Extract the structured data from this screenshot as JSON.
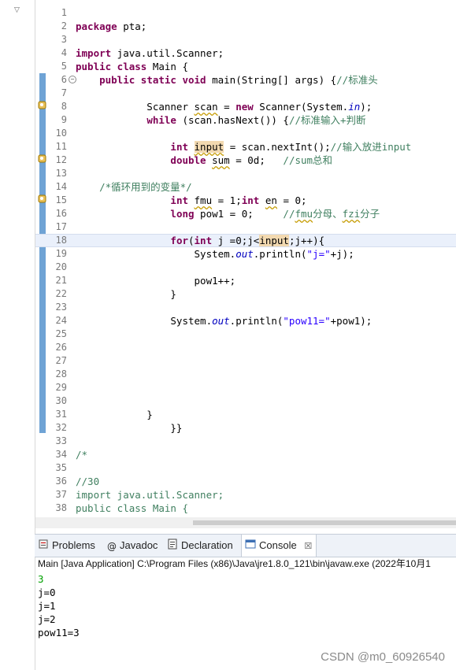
{
  "editor": {
    "lines": [
      {
        "n": "1",
        "text": ""
      },
      {
        "n": "2",
        "text": "package pta;"
      },
      {
        "n": "3",
        "text": ""
      },
      {
        "n": "4",
        "text": "import java.util.Scanner;"
      },
      {
        "n": "5",
        "text": "public class Main {"
      },
      {
        "n": "6",
        "text": "    public static void main(String[] args) {//标准头"
      },
      {
        "n": "7",
        "text": ""
      },
      {
        "n": "8",
        "text": "            Scanner scan = new Scanner(System.in);"
      },
      {
        "n": "9",
        "text": "            while (scan.hasNext()) {//标准输入+判断"
      },
      {
        "n": "10",
        "text": ""
      },
      {
        "n": "11",
        "text": "                int input = scan.nextInt();//输入放进input"
      },
      {
        "n": "12",
        "text": "                double sum = 0d;   //sum总和"
      },
      {
        "n": "13",
        "text": ""
      },
      {
        "n": "14",
        "text": "    /*循环用到的变量*/"
      },
      {
        "n": "15",
        "text": "                int fmu = 1;int en = 0;"
      },
      {
        "n": "16",
        "text": "                long pow1 = 0;     //fmu分母、fzi分子"
      },
      {
        "n": "17",
        "text": ""
      },
      {
        "n": "18",
        "text": "                for(int j =0;j<input;j++){"
      },
      {
        "n": "19",
        "text": "                    System.out.println(\"j=\"+j);"
      },
      {
        "n": "20",
        "text": ""
      },
      {
        "n": "21",
        "text": "                    pow1++;"
      },
      {
        "n": "22",
        "text": "                }"
      },
      {
        "n": "23",
        "text": ""
      },
      {
        "n": "24",
        "text": "                System.out.println(\"pow11=\"+pow1);"
      },
      {
        "n": "25",
        "text": ""
      },
      {
        "n": "26",
        "text": ""
      },
      {
        "n": "27",
        "text": ""
      },
      {
        "n": "28",
        "text": ""
      },
      {
        "n": "29",
        "text": ""
      },
      {
        "n": "30",
        "text": ""
      },
      {
        "n": "31",
        "text": "            }"
      },
      {
        "n": "32",
        "text": "                }}"
      },
      {
        "n": "33",
        "text": ""
      },
      {
        "n": "34",
        "text": "/*"
      },
      {
        "n": "35",
        "text": ""
      },
      {
        "n": "36",
        "text": "//30"
      },
      {
        "n": "37",
        "text": "import java.util.Scanner;"
      },
      {
        "n": "38",
        "text": "public class Main {"
      }
    ]
  },
  "tabs": [
    {
      "label": "Problems",
      "icon": "problems-icon"
    },
    {
      "label": "Javadoc",
      "icon": "javadoc-icon"
    },
    {
      "label": "Declaration",
      "icon": "declaration-icon"
    },
    {
      "label": "Console",
      "icon": "console-icon",
      "active": true,
      "close": "☒"
    }
  ],
  "console": {
    "header": "Main [Java Application] C:\\Program Files (x86)\\Java\\jre1.8.0_121\\bin\\javaw.exe (2022年10月1",
    "lines": [
      "3",
      "j=0",
      "j=1",
      "j=2",
      "pow11=3"
    ]
  },
  "watermark": "CSDN @m0_60926540",
  "colors": {
    "keyword": "#7f0055",
    "comment": "#3f7f5f",
    "string": "#2a00ff",
    "field": "#0000c0",
    "console_input": "#00a000",
    "ruler": "#6fa3d5"
  }
}
